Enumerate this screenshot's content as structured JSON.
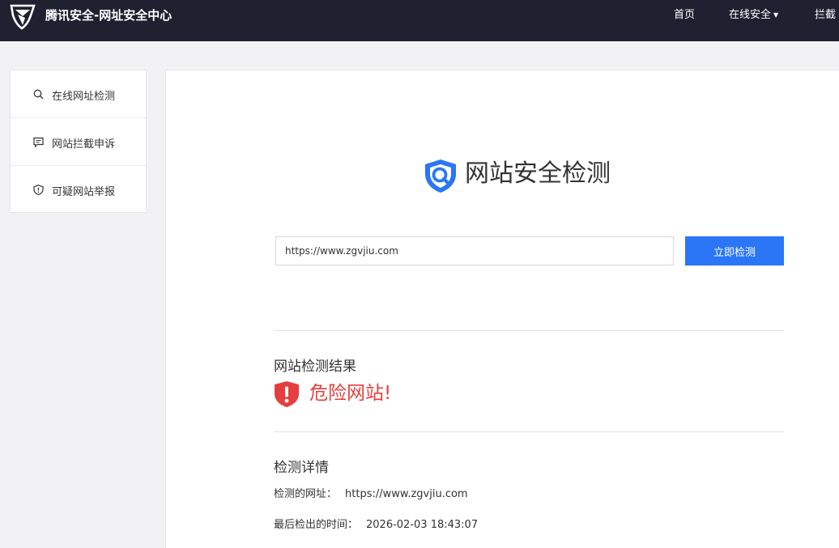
{
  "header": {
    "brand": "腾讯安全-网址安全中心",
    "nav": [
      "首页",
      "在线安全",
      "拦截"
    ]
  },
  "sidebar": {
    "items": [
      {
        "label": "在线网址检测",
        "icon": "search-icon"
      },
      {
        "label": "网站拦截申诉",
        "icon": "message-icon"
      },
      {
        "label": "可疑网站举报",
        "icon": "shield-alert-icon"
      }
    ]
  },
  "main": {
    "title": "网站安全检测",
    "url_value": "https://www.zgvjiu.com",
    "check_button": "立即检测",
    "result_title": "网站检测结果",
    "result_status": "危险网站!",
    "details_title": "检测详情",
    "details": [
      {
        "label": "检测的网址：",
        "value": "https://www.zgvjiu.com"
      },
      {
        "label": "最后检出的时间：",
        "value": "2026-02-03 18:43:07"
      }
    ]
  },
  "colors": {
    "header_bg": "#1f2131",
    "accent": "#2a76f6",
    "danger": "#e63e3e",
    "page_bg": "#f2f2f4"
  }
}
